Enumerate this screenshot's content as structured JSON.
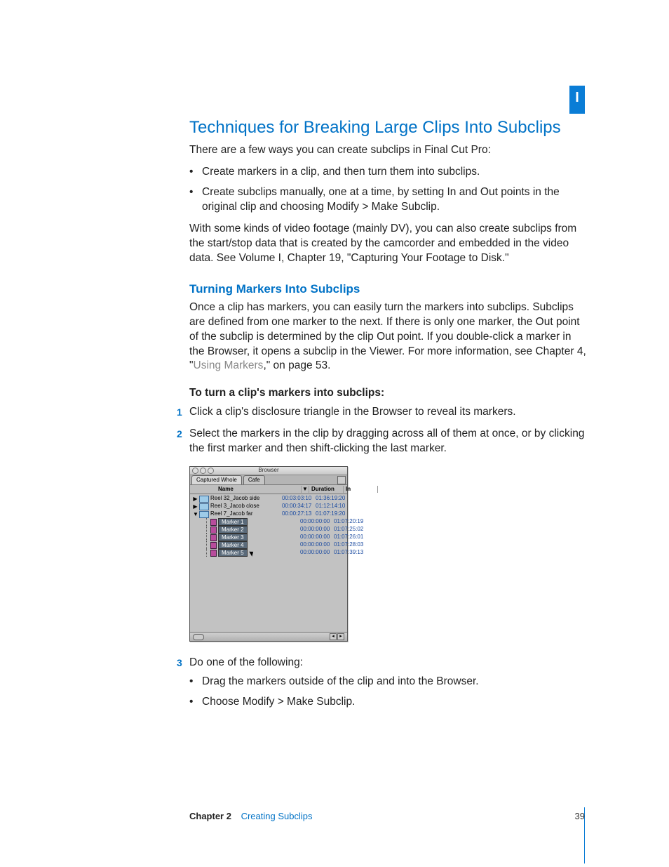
{
  "side_tab": "I",
  "h1": "Techniques for Breaking Large Clips Into Subclips",
  "p_intro": "There are a few ways you can create subclips in Final Cut Pro:",
  "bullets_intro": [
    "Create markers in a clip, and then turn them into subclips.",
    "Create subclips manually, one at a time, by setting In and Out points in the original clip and choosing Modify > Make Subclip."
  ],
  "p_dv": "With some kinds of video footage (mainly DV), you can also create subclips from the start/stop data that is created by the camcorder and embedded in the video data. See Volume I, Chapter 19, \"Capturing Your Footage to Disk.\"",
  "h2": "Turning Markers Into Subclips",
  "p_turn_a": "Once a clip has markers, you can easily turn the markers into subclips. Subclips are defined from one marker to the next. If there is only one marker, the Out point of the subclip is determined by the clip Out point. If you double-click a marker in the Browser, it opens a subclip in the Viewer. For more information, see Chapter 4, \"",
  "link_markers": "Using Markers",
  "p_turn_b": ",\" on page 53.",
  "instr_bold": "To turn a clip's markers into subclips:",
  "steps": {
    "s1": "Click a clip's disclosure triangle in the Browser to reveal its markers.",
    "s2": "Select the markers in the clip by dragging across all of them at once, or by clicking the first marker and then shift-clicking the last marker.",
    "s3": "Do one of the following:"
  },
  "sub_steps3": [
    "Drag the markers outside of the clip and into the Browser.",
    "Choose Modify > Make Subclip."
  ],
  "browser": {
    "title": "Browser",
    "tabs": [
      "Captured Whole",
      "Cafe"
    ],
    "columns": {
      "name": "Name",
      "sort": "▼",
      "duration": "Duration",
      "in": "In"
    },
    "rows": [
      {
        "type": "clip",
        "open": "▶",
        "name": "Reel 32_Jacob side",
        "dur": "00:03:03:10",
        "in": "01:36:19:20"
      },
      {
        "type": "clip",
        "open": "▶",
        "name": "Reel 3_Jacob close",
        "dur": "00:00:34:17",
        "in": "01:12:14:10"
      },
      {
        "type": "clip",
        "open": "▼",
        "name": "Reel 7_Jacob far",
        "dur": "00:00:27:13",
        "in": "01:07:19:20"
      },
      {
        "type": "marker",
        "name": "Marker 1",
        "dur": "00:00:00:00",
        "in": "01:07:20:19",
        "sel": true
      },
      {
        "type": "marker",
        "name": "Marker 2",
        "dur": "00:00:00:00",
        "in": "01:07:25:02",
        "sel": true
      },
      {
        "type": "marker",
        "name": "Marker 3",
        "dur": "00:00:00:00",
        "in": "01:07:26:01",
        "sel": true
      },
      {
        "type": "marker",
        "name": "Marker 4",
        "dur": "00:00:00:00",
        "in": "01:07:28:03",
        "sel": true
      },
      {
        "type": "marker",
        "name": "Marker 5",
        "dur": "00:00:00:00",
        "in": "01:07:39:13",
        "sel": true,
        "cursor": true
      }
    ]
  },
  "footer": {
    "chapter": "Chapter 2",
    "title": "Creating Subclips",
    "page": "39"
  }
}
